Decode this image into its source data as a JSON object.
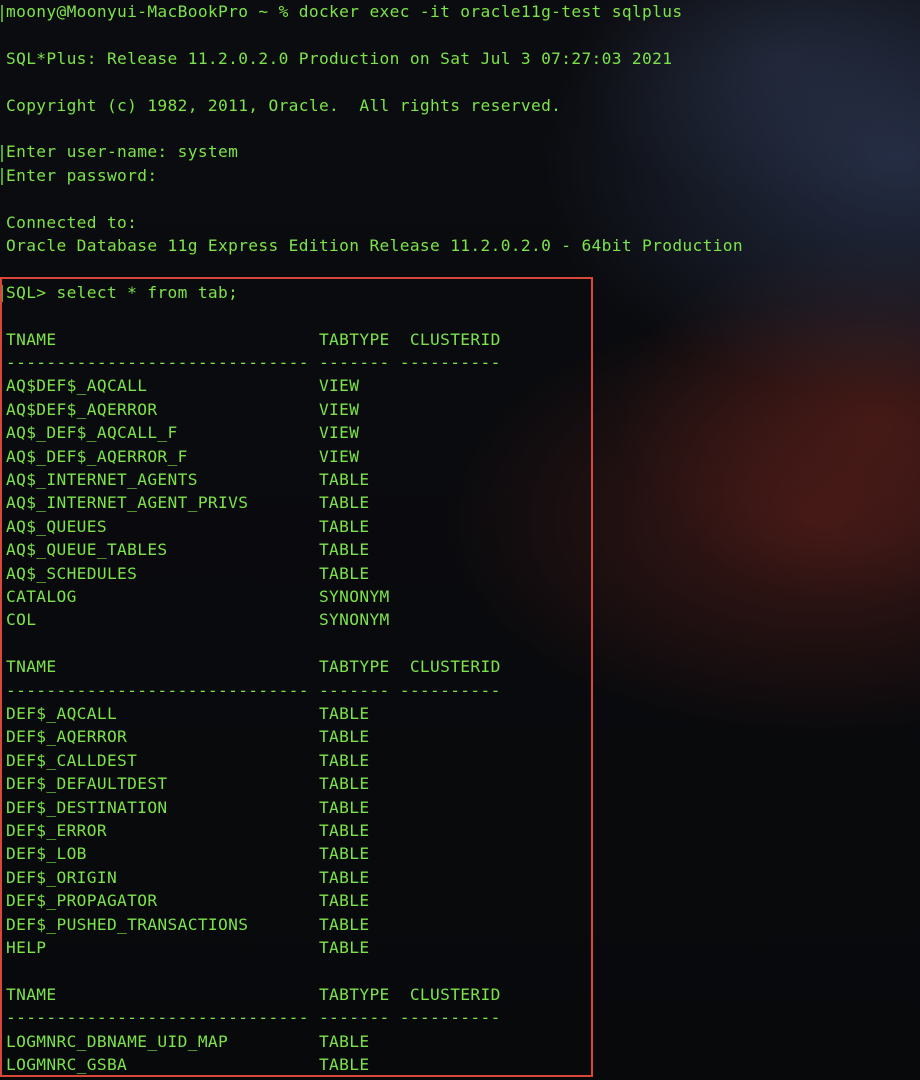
{
  "terminal": {
    "prompt_line": "moony@Moonyui-MacBookPro ~ % docker exec -it oracle11g-test sqlplus",
    "banner": "SQL*Plus: Release 11.2.0.2.0 Production on Sat Jul 3 07:27:03 2021",
    "copyright": "Copyright (c) 1982, 2011, Oracle.  All rights reserved.",
    "username_line": "Enter user-name: system",
    "password_line": "Enter password:",
    "connected_label": "Connected to:",
    "connected_db": "Oracle Database 11g Express Edition Release 11.2.0.2.0 - 64bit Production",
    "sql_command": "SQL> select * from tab;"
  },
  "query_result": {
    "columns": [
      "TNAME",
      "TABTYPE",
      "CLUSTERID"
    ],
    "header_line": "TNAME                          TABTYPE  CLUSTERID",
    "separator_line": "------------------------------ ------- ----------",
    "groups": [
      [
        "AQ$DEF$_AQCALL                 VIEW",
        "AQ$DEF$_AQERROR                VIEW",
        "AQ$_DEF$_AQCALL_F              VIEW",
        "AQ$_DEF$_AQERROR_F             VIEW",
        "AQ$_INTERNET_AGENTS            TABLE",
        "AQ$_INTERNET_AGENT_PRIVS       TABLE",
        "AQ$_QUEUES                     TABLE",
        "AQ$_QUEUE_TABLES               TABLE",
        "AQ$_SCHEDULES                  TABLE",
        "CATALOG                        SYNONYM",
        "COL                            SYNONYM"
      ],
      [
        "DEF$_AQCALL                    TABLE",
        "DEF$_AQERROR                   TABLE",
        "DEF$_CALLDEST                  TABLE",
        "DEF$_DEFAULTDEST               TABLE",
        "DEF$_DESTINATION               TABLE",
        "DEF$_ERROR                     TABLE",
        "DEF$_LOB                       TABLE",
        "DEF$_ORIGIN                    TABLE",
        "DEF$_PROPAGATOR                TABLE",
        "DEF$_PUSHED_TRANSACTIONS       TABLE",
        "HELP                           TABLE"
      ],
      [
        "LOGMNRC_DBNAME_UID_MAP         TABLE",
        "LOGMNRC_GSBA                   TABLE"
      ]
    ]
  },
  "colors": {
    "text": "#7ce34a",
    "highlight_border": "#d9463a",
    "background": "#08090c"
  }
}
